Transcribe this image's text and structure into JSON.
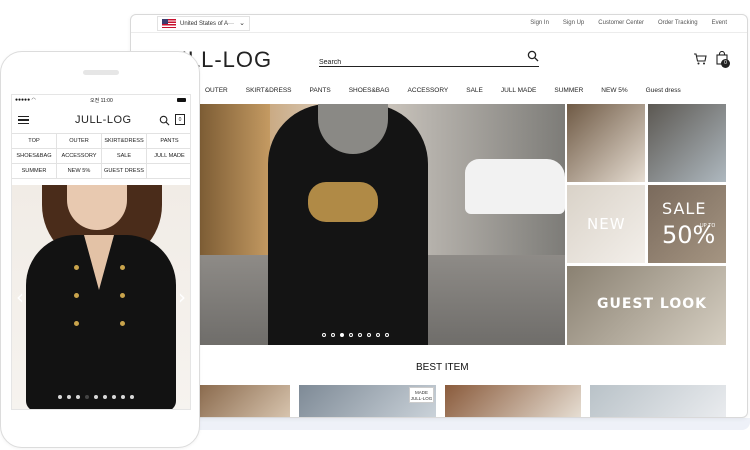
{
  "desktop": {
    "country": "United States of A···",
    "top_links": [
      "Sign In",
      "Sign Up",
      "Customer Center",
      "Order Tracking",
      "Event"
    ],
    "logo": "JULL-LOG",
    "search_placeholder": "Search",
    "bag_count": "0",
    "nav": [
      "OUTER",
      "SKIRT&DRESS",
      "PANTS",
      "SHOES&BAG",
      "ACCESSORY",
      "SALE",
      "JULL MADE",
      "SUMMER",
      "NEW 5%",
      "Guest dress"
    ],
    "hero_slide_count": 8,
    "hero_active_slide": 2,
    "tiles": {
      "new": "NEW",
      "sale": "SALE",
      "sale_percent": "50%",
      "upto": "UP TO",
      "guest_look": "GUEST LOOK"
    },
    "best_item_title": "BEST ITEM",
    "made_badge": [
      "MADE",
      "JULL-LOG"
    ]
  },
  "mobile": {
    "time": "오전 11:00",
    "logo": "JULL-LOG",
    "bag_count": "0",
    "menu": [
      "TOP",
      "OUTER",
      "SKIRT&DRESS",
      "PANTS",
      "SHOES&BAG",
      "ACCESSORY",
      "SALE",
      "JULL MADE",
      "SUMMER",
      "NEW 5%",
      "GUEST DRESS",
      ""
    ],
    "slide_count": 9,
    "active_slide": 3
  },
  "colors": {
    "text": "#222222",
    "border": "#dcdcdc",
    "accent_gold": "#b08a46"
  },
  "icons": [
    "search-icon",
    "cart-icon",
    "bag-icon",
    "hamburger-icon",
    "chevron-left-icon",
    "chevron-right-icon",
    "us-flag-icon"
  ]
}
